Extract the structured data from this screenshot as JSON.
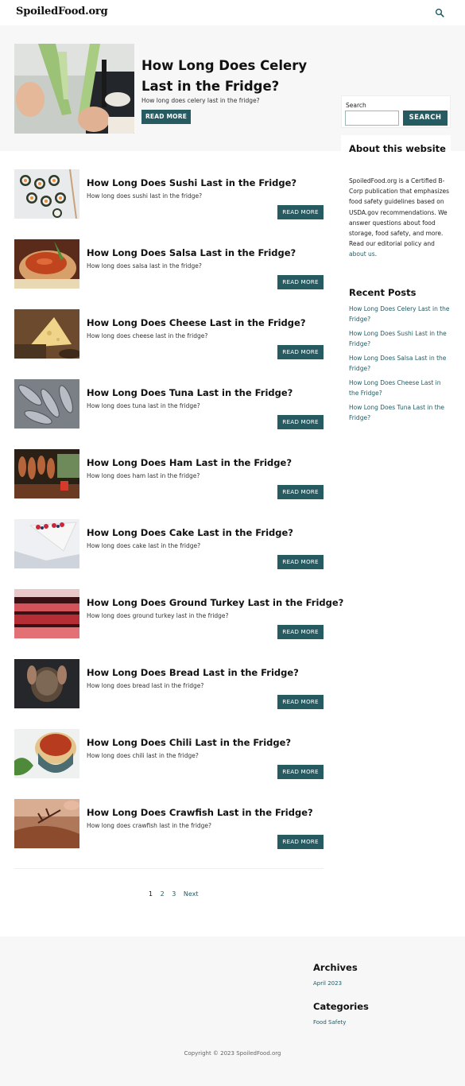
{
  "header": {
    "logo": "SpoiledFood.org",
    "search_icon": "search-icon"
  },
  "hero": {
    "title": "How Long Does Celery Last in the Fridge?",
    "subtitle": "How long does celery last in the fridge?",
    "button": "READ MORE"
  },
  "sidebar": {
    "search_label": "Search",
    "search_value": "",
    "search_button": "SEARCH",
    "about_title": "About this website",
    "about_text": "SpoiledFood.org is a Certified B-Corp publication that emphasizes food safety guidelines based on USDA.gov recommendations. We answer questions about food storage, food safety, and more. Read our editorial policy and",
    "about_link": "about us",
    "about_end": ".",
    "recent_title": "Recent Posts",
    "recent": [
      "How Long Does Celery Last in the Fridge?",
      "How Long Does Sushi Last in the Fridge?",
      "How Long Does Salsa Last in the Fridge?",
      "How Long Does Cheese Last in the Fridge?",
      "How Long Does Tuna Last in the Fridge?"
    ]
  },
  "posts": [
    {
      "title": "How Long Does Sushi Last in the Fridge?",
      "subtitle": "How long does sushi last in the fridge?",
      "button": "READ MORE"
    },
    {
      "title": "How Long Does Salsa Last in the Fridge?",
      "subtitle": "How long does salsa last in the fridge?",
      "button": "READ MORE"
    },
    {
      "title": "How Long Does Cheese Last in the Fridge?",
      "subtitle": "How long does cheese last in the fridge?",
      "button": "READ MORE"
    },
    {
      "title": "How Long Does Tuna Last in the Fridge?",
      "subtitle": "How long does tuna last in the fridge?",
      "button": "READ MORE"
    },
    {
      "title": "How Long Does Ham Last in the Fridge?",
      "subtitle": "How long does ham last in the fridge?",
      "button": "READ MORE"
    },
    {
      "title": "How Long Does Cake Last in the Fridge?",
      "subtitle": "How long does cake last in the fridge?",
      "button": "READ MORE"
    },
    {
      "title": "How Long Does Ground Turkey Last in the Fridge?",
      "subtitle": "How long does ground turkey last in the fridge?",
      "button": "READ MORE"
    },
    {
      "title": "How Long Does Bread Last in the Fridge?",
      "subtitle": "How long does bread last in the fridge?",
      "button": "READ MORE"
    },
    {
      "title": "How Long Does Chili Last in the Fridge?",
      "subtitle": "How long does chili last in the fridge?",
      "button": "READ MORE"
    },
    {
      "title": "How Long Does Crawfish Last in the Fridge?",
      "subtitle": "How long does crawfish last in the fridge?",
      "button": "READ MORE"
    }
  ],
  "pagination": {
    "pages": [
      "1",
      "2",
      "3"
    ],
    "next": "Next"
  },
  "footer": {
    "archives_title": "Archives",
    "archives_link": "April 2023",
    "categories_title": "Categories",
    "categories_link": "Food Safety",
    "copyright": "Copyright © 2023 SpoiledFood.org"
  },
  "colors": {
    "accent": "#275b62",
    "link": "#1f5c63",
    "hero_bg": "#f7f7f8"
  }
}
